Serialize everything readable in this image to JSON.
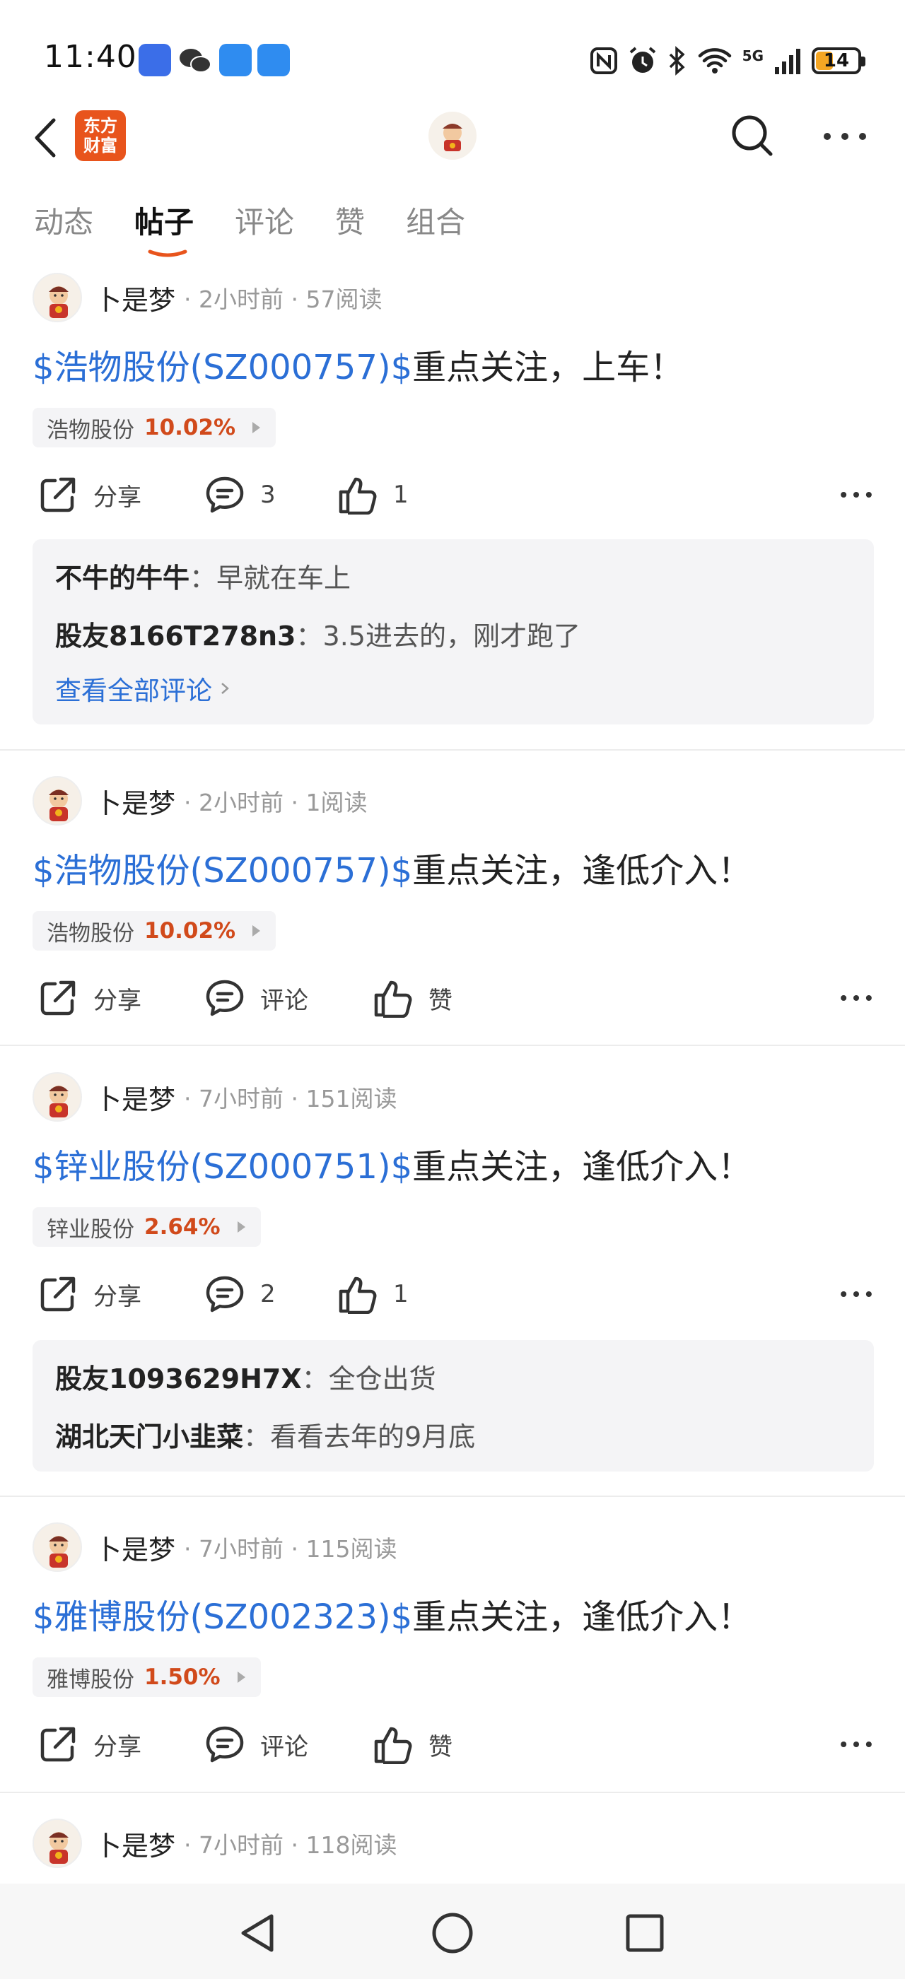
{
  "status_bar": {
    "time": "11:40",
    "battery": "14",
    "network": "5G"
  },
  "header": {
    "brand_line1": "东方",
    "brand_line2": "财富"
  },
  "tabs": [
    {
      "label": "动态"
    },
    {
      "label": "帖子"
    },
    {
      "label": "评论"
    },
    {
      "label": "赞"
    },
    {
      "label": "组合"
    }
  ],
  "active_tab": "帖子",
  "posts": [
    {
      "author": "卜是梦",
      "meta": "· 2小时前 · 57阅读",
      "stock_tag": "$浩物股份(SZ000757)$",
      "text": "重点关注，上车！",
      "chip_name": "浩物股份",
      "chip_pct": "10.02%",
      "share": "分享",
      "comment": "3",
      "like": "1",
      "comments": [
        {
          "name": "不牛的牛牛",
          "text": "早就在车上"
        },
        {
          "name": "股友8166T278n3",
          "text": "3.5进去的，刚才跑了"
        }
      ],
      "see_all": "查看全部评论"
    },
    {
      "author": "卜是梦",
      "meta": "· 2小时前 · 1阅读",
      "stock_tag": "$浩物股份(SZ000757)$",
      "text": "重点关注，逢低介入！",
      "chip_name": "浩物股份",
      "chip_pct": "10.02%",
      "share": "分享",
      "comment": "评论",
      "like": "赞"
    },
    {
      "author": "卜是梦",
      "meta": "· 7小时前 · 151阅读",
      "stock_tag": "$锌业股份(SZ000751)$",
      "text": "重点关注，逢低介入！",
      "chip_name": "锌业股份",
      "chip_pct": "2.64%",
      "share": "分享",
      "comment": "2",
      "like": "1",
      "comments": [
        {
          "name": "股友1093629H7X",
          "text": "全仓出货"
        },
        {
          "name": "湖北天门小韭菜",
          "text": "看看去年的9月底"
        }
      ]
    },
    {
      "author": "卜是梦",
      "meta": "· 7小时前 · 115阅读",
      "stock_tag": "$雅博股份(SZ002323)$",
      "text": "重点关注，逢低介入！",
      "chip_name": "雅博股份",
      "chip_pct": "1.50%",
      "share": "分享",
      "comment": "评论",
      "like": "赞"
    },
    {
      "author": "卜是梦",
      "meta": "· 7小时前 · 118阅读"
    }
  ],
  "colors": {
    "accent": "#2b6fd6",
    "rise": "#d14a1b",
    "brand": "#e8541c"
  }
}
